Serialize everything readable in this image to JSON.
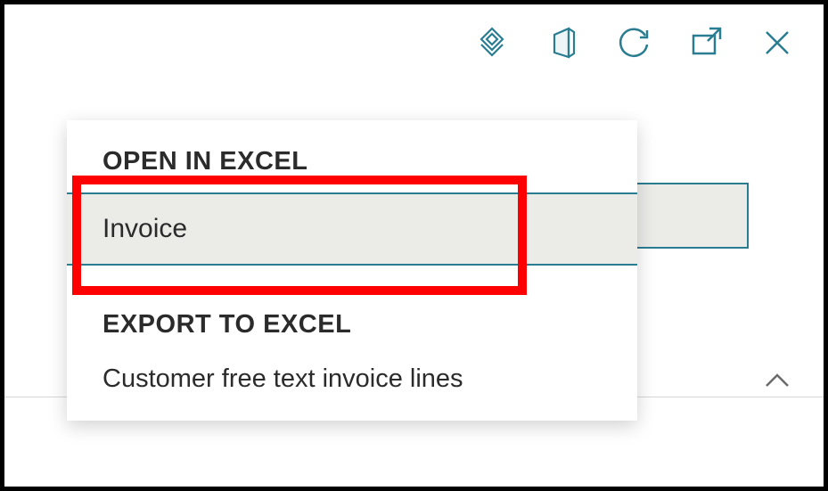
{
  "colors": {
    "icon_stroke": "#2a7d91",
    "highlight": "#ff0000"
  },
  "toolbar": {
    "integration_icon": "integration-icon",
    "office_icon": "office-icon",
    "refresh_icon": "refresh-icon",
    "open_new_icon": "open-new-window-icon",
    "close_icon": "close-icon"
  },
  "menu": {
    "open_in_excel": {
      "heading": "OPEN IN EXCEL",
      "items": [
        {
          "label": "Invoice",
          "selected": true
        }
      ]
    },
    "export_to_excel": {
      "heading": "EXPORT TO EXCEL",
      "items": [
        {
          "label": "Customer free text invoice lines"
        }
      ]
    }
  }
}
